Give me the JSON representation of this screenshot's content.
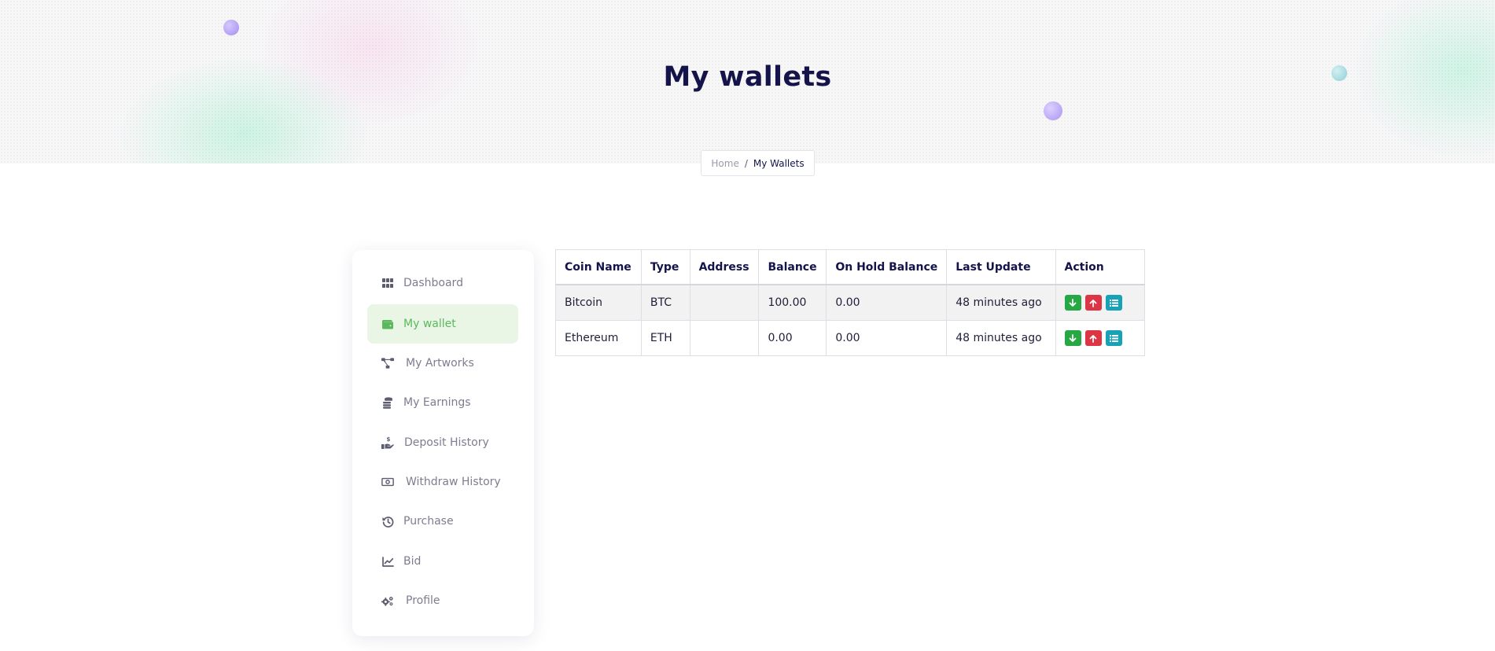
{
  "header": {
    "title": "My wallets",
    "breadcrumb": {
      "home": "Home",
      "separator": "/",
      "current": "My Wallets"
    }
  },
  "sidebar": {
    "items": [
      {
        "label": "Dashboard",
        "icon": "grid-icon",
        "active": false
      },
      {
        "label": "My wallet",
        "icon": "wallet-icon",
        "active": true
      },
      {
        "label": "My Artworks",
        "icon": "network-icon",
        "active": false
      },
      {
        "label": "My Earnings",
        "icon": "coins-icon",
        "active": false
      },
      {
        "label": "Deposit History",
        "icon": "hand-dollar-icon",
        "active": false
      },
      {
        "label": "Withdraw History",
        "icon": "money-bill-icon",
        "active": false
      },
      {
        "label": "Purchase",
        "icon": "history-icon",
        "active": false
      },
      {
        "label": "Bid",
        "icon": "chart-line-icon",
        "active": false
      },
      {
        "label": "Profile",
        "icon": "gears-icon",
        "active": false
      }
    ]
  },
  "table": {
    "headers": [
      "Coin Name",
      "Type",
      "Address",
      "Balance",
      "On Hold Balance",
      "Last Update",
      "Action"
    ],
    "rows": [
      {
        "coin": "Bitcoin",
        "type": "BTC",
        "address": "",
        "balance": "100.00",
        "on_hold": "0.00",
        "updated": "48 minutes ago"
      },
      {
        "coin": "Ethereum",
        "type": "ETH",
        "address": "",
        "balance": "0.00",
        "on_hold": "0.00",
        "updated": "48 minutes ago"
      }
    ],
    "actions": [
      "deposit-icon",
      "withdraw-icon",
      "list-icon"
    ]
  },
  "colors": {
    "title": "#14144b",
    "active_nav_bg": "#e9f6e6",
    "active_nav_text": "#5cb85c",
    "deposit": "#28a745",
    "withdraw": "#dc3545",
    "list": "#17a2b8"
  }
}
